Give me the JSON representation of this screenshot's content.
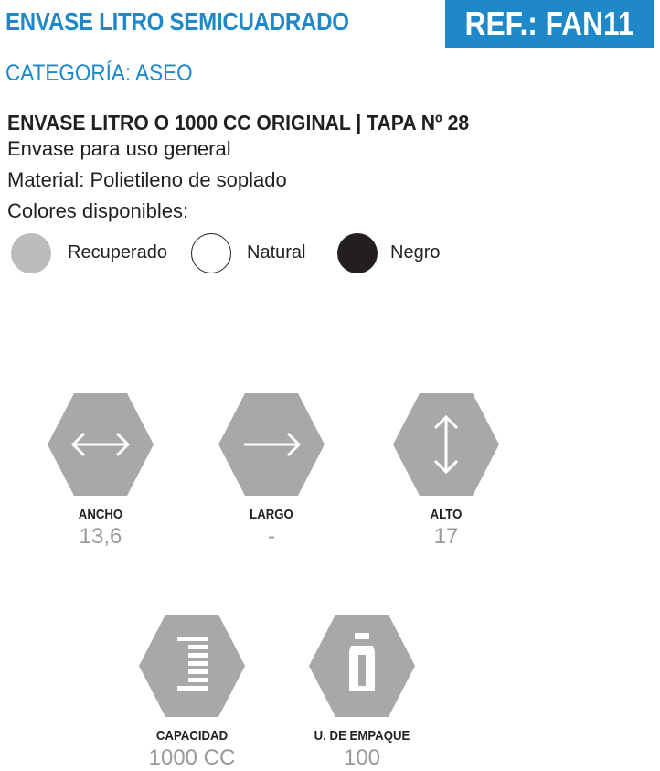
{
  "header": {
    "title": "ENVASE LITRO SEMICUADRADO",
    "ref": "REF.: FAN11",
    "category": "CATEGORÍA: ASEO"
  },
  "product": {
    "subtitle": "ENVASE  LITRO  O 1000 CC ORIGINAL | TAPA Nº 28",
    "usage": "Envase para uso general",
    "material": "Material: Polietileno de soplado",
    "colors_heading": "Colores disponibles:",
    "colors": [
      {
        "label": "Recuperado",
        "color": "#bcbcbc"
      },
      {
        "label": "Natural",
        "color": "#ffffff"
      },
      {
        "label": "Negro",
        "color": "#231f20"
      }
    ]
  },
  "specs": {
    "ancho": {
      "label": "ANCHO",
      "value": "13,6",
      "icon": "horizontal-double-arrow-icon"
    },
    "largo": {
      "label": "LARGO",
      "value": "-",
      "icon": "right-arrow-icon"
    },
    "alto": {
      "label": "ALTO",
      "value": "17",
      "icon": "vertical-double-arrow-icon"
    },
    "capacidad": {
      "label": "CAPACIDAD",
      "value": "1000 CC",
      "icon": "measuring-scale-icon"
    },
    "empaque": {
      "label": "U. DE EMPAQUE",
      "value": "100",
      "icon": "bottle-icon"
    }
  },
  "colors": {
    "brand_blue": "#1f88c9",
    "hex_gray": "#a8a8a8",
    "value_gray": "#999999"
  }
}
